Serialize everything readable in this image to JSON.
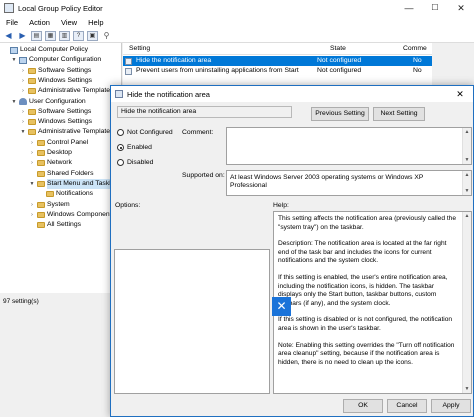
{
  "window": {
    "title": "Local Group Policy Editor",
    "minimize": "—",
    "maximize": "☐",
    "close": "✕"
  },
  "menu": [
    "File",
    "Action",
    "View",
    "Help"
  ],
  "tree": [
    {
      "label": "Local Computer Policy",
      "indent": 0,
      "twisty": "",
      "icon": "pc"
    },
    {
      "label": "Computer Configuration",
      "indent": 1,
      "twisty": "▼",
      "icon": "pc"
    },
    {
      "label": "Software Settings",
      "indent": 2,
      "twisty": "›",
      "icon": "folder"
    },
    {
      "label": "Windows Settings",
      "indent": 2,
      "twisty": "›",
      "icon": "folder"
    },
    {
      "label": "Administrative Templates",
      "indent": 2,
      "twisty": "›",
      "icon": "folder"
    },
    {
      "label": "User Configuration",
      "indent": 1,
      "twisty": "▼",
      "icon": "user"
    },
    {
      "label": "Software Settings",
      "indent": 2,
      "twisty": "›",
      "icon": "folder"
    },
    {
      "label": "Windows Settings",
      "indent": 2,
      "twisty": "›",
      "icon": "folder"
    },
    {
      "label": "Administrative Templates",
      "indent": 2,
      "twisty": "▼",
      "icon": "folder"
    },
    {
      "label": "Control Panel",
      "indent": 3,
      "twisty": "›",
      "icon": "folder"
    },
    {
      "label": "Desktop",
      "indent": 3,
      "twisty": "›",
      "icon": "folder"
    },
    {
      "label": "Network",
      "indent": 3,
      "twisty": "›",
      "icon": "folder"
    },
    {
      "label": "Shared Folders",
      "indent": 3,
      "twisty": "",
      "icon": "folder"
    },
    {
      "label": "Start Menu and Taskbar",
      "indent": 3,
      "twisty": "▼",
      "icon": "folder",
      "selected": true
    },
    {
      "label": "Notifications",
      "indent": 4,
      "twisty": "",
      "icon": "folder"
    },
    {
      "label": "System",
      "indent": 3,
      "twisty": "›",
      "icon": "folder"
    },
    {
      "label": "Windows Components",
      "indent": 3,
      "twisty": "›",
      "icon": "folder"
    },
    {
      "label": "All Settings",
      "indent": 3,
      "twisty": "",
      "icon": "folder"
    }
  ],
  "list": {
    "columns": {
      "setting": "Setting",
      "state": "State",
      "comment": "Comme"
    },
    "rows": [
      {
        "setting": "Hide the notification area",
        "state": "Not configured",
        "comment": "No",
        "selected": true
      },
      {
        "setting": "Prevent users from uninstalling applications from Start",
        "state": "Not configured",
        "comment": "No"
      }
    ]
  },
  "status": "97 setting(s)",
  "dialog": {
    "title": "Hide the notification area",
    "policy_name": "Hide the notification area",
    "prev_button": "Previous Setting",
    "next_button": "Next Setting",
    "options": [
      {
        "label": "Not Configured",
        "checked": false
      },
      {
        "label": "Enabled",
        "checked": true
      },
      {
        "label": "Disabled",
        "checked": false
      }
    ],
    "comment_label": "Comment:",
    "supported_label": "Supported on:",
    "supported_text": "At least Windows Server 2003 operating systems or Windows XP Professional",
    "options_label": "Options:",
    "help_label": "Help:",
    "help_paragraphs": [
      "This setting affects the notification area (previously called the \"system tray\") on the taskbar.",
      "Description: The notification area is located at the far right end of the task bar and includes the icons for current notifications and the system clock.",
      "If this setting is enabled, the user's entire notification area, including the notification icons, is hidden. The taskbar displays only the Start button, taskbar buttons, custom toolbars (if any), and the system clock.",
      "If this setting is disabled or is not configured, the notification area is shown in the user's taskbar.",
      "Note: Enabling this setting overrides the \"Turn off notification area cleanup\" setting, because if the notification area is hidden, there is no need to clean up the icons."
    ],
    "ok": "OK",
    "cancel": "Cancel",
    "apply": "Apply",
    "close": "✕"
  },
  "badge": "✕"
}
